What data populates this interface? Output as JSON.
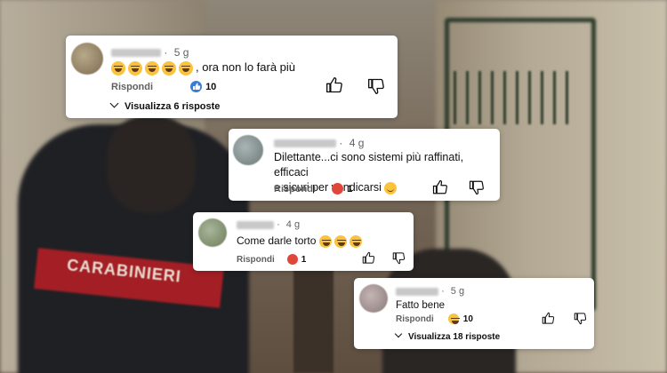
{
  "comments": [
    {
      "age": "5 g",
      "text": ", ora non lo farà più",
      "emoji_count": 5,
      "reply_label": "Rispondi",
      "reaction": "like-icon",
      "reaction_count": "10",
      "replies_label": "Visualizza 6 risposte"
    },
    {
      "age": "4 g",
      "text_line1": "Dilettante...ci sono sistemi più raffinati, efficaci",
      "text_line2": "e sicuri per vendicarsi",
      "reply_label": "Rispondi",
      "reaction": "angry-icon",
      "reaction_count": "1"
    },
    {
      "age": "4 g",
      "text": "Come darle torto",
      "reply_label": "Rispondi",
      "reaction": "angry-icon",
      "reaction_count": "1"
    },
    {
      "age": "5 g",
      "text": "Fatto bene",
      "reply_label": "Rispondi",
      "reaction": "laugh-icon",
      "reaction_count": "10",
      "replies_label": "Visualizza 18 risposte"
    }
  ],
  "background_scene": {
    "uniform_text": "CARABINIERI"
  },
  "colors": {
    "like_blue": "#3a7bd5",
    "angry_red": "#e0463a",
    "laugh_yellow": "#f9c33c"
  }
}
